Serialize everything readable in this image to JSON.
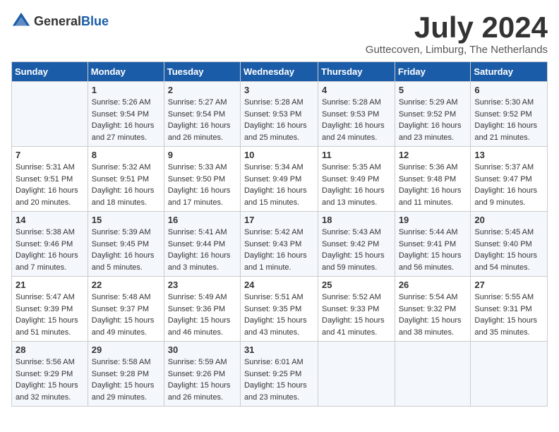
{
  "header": {
    "logo": {
      "text1": "General",
      "text2": "Blue"
    },
    "title": "July 2024",
    "location": "Guttecoven, Limburg, The Netherlands"
  },
  "columns": [
    "Sunday",
    "Monday",
    "Tuesday",
    "Wednesday",
    "Thursday",
    "Friday",
    "Saturday"
  ],
  "weeks": [
    [
      {
        "day": "",
        "info": ""
      },
      {
        "day": "1",
        "info": "Sunrise: 5:26 AM\nSunset: 9:54 PM\nDaylight: 16 hours\nand 27 minutes."
      },
      {
        "day": "2",
        "info": "Sunrise: 5:27 AM\nSunset: 9:54 PM\nDaylight: 16 hours\nand 26 minutes."
      },
      {
        "day": "3",
        "info": "Sunrise: 5:28 AM\nSunset: 9:53 PM\nDaylight: 16 hours\nand 25 minutes."
      },
      {
        "day": "4",
        "info": "Sunrise: 5:28 AM\nSunset: 9:53 PM\nDaylight: 16 hours\nand 24 minutes."
      },
      {
        "day": "5",
        "info": "Sunrise: 5:29 AM\nSunset: 9:52 PM\nDaylight: 16 hours\nand 23 minutes."
      },
      {
        "day": "6",
        "info": "Sunrise: 5:30 AM\nSunset: 9:52 PM\nDaylight: 16 hours\nand 21 minutes."
      }
    ],
    [
      {
        "day": "7",
        "info": "Sunrise: 5:31 AM\nSunset: 9:51 PM\nDaylight: 16 hours\nand 20 minutes."
      },
      {
        "day": "8",
        "info": "Sunrise: 5:32 AM\nSunset: 9:51 PM\nDaylight: 16 hours\nand 18 minutes."
      },
      {
        "day": "9",
        "info": "Sunrise: 5:33 AM\nSunset: 9:50 PM\nDaylight: 16 hours\nand 17 minutes."
      },
      {
        "day": "10",
        "info": "Sunrise: 5:34 AM\nSunset: 9:49 PM\nDaylight: 16 hours\nand 15 minutes."
      },
      {
        "day": "11",
        "info": "Sunrise: 5:35 AM\nSunset: 9:49 PM\nDaylight: 16 hours\nand 13 minutes."
      },
      {
        "day": "12",
        "info": "Sunrise: 5:36 AM\nSunset: 9:48 PM\nDaylight: 16 hours\nand 11 minutes."
      },
      {
        "day": "13",
        "info": "Sunrise: 5:37 AM\nSunset: 9:47 PM\nDaylight: 16 hours\nand 9 minutes."
      }
    ],
    [
      {
        "day": "14",
        "info": "Sunrise: 5:38 AM\nSunset: 9:46 PM\nDaylight: 16 hours\nand 7 minutes."
      },
      {
        "day": "15",
        "info": "Sunrise: 5:39 AM\nSunset: 9:45 PM\nDaylight: 16 hours\nand 5 minutes."
      },
      {
        "day": "16",
        "info": "Sunrise: 5:41 AM\nSunset: 9:44 PM\nDaylight: 16 hours\nand 3 minutes."
      },
      {
        "day": "17",
        "info": "Sunrise: 5:42 AM\nSunset: 9:43 PM\nDaylight: 16 hours\nand 1 minute."
      },
      {
        "day": "18",
        "info": "Sunrise: 5:43 AM\nSunset: 9:42 PM\nDaylight: 15 hours\nand 59 minutes."
      },
      {
        "day": "19",
        "info": "Sunrise: 5:44 AM\nSunset: 9:41 PM\nDaylight: 15 hours\nand 56 minutes."
      },
      {
        "day": "20",
        "info": "Sunrise: 5:45 AM\nSunset: 9:40 PM\nDaylight: 15 hours\nand 54 minutes."
      }
    ],
    [
      {
        "day": "21",
        "info": "Sunrise: 5:47 AM\nSunset: 9:39 PM\nDaylight: 15 hours\nand 51 minutes."
      },
      {
        "day": "22",
        "info": "Sunrise: 5:48 AM\nSunset: 9:37 PM\nDaylight: 15 hours\nand 49 minutes."
      },
      {
        "day": "23",
        "info": "Sunrise: 5:49 AM\nSunset: 9:36 PM\nDaylight: 15 hours\nand 46 minutes."
      },
      {
        "day": "24",
        "info": "Sunrise: 5:51 AM\nSunset: 9:35 PM\nDaylight: 15 hours\nand 43 minutes."
      },
      {
        "day": "25",
        "info": "Sunrise: 5:52 AM\nSunset: 9:33 PM\nDaylight: 15 hours\nand 41 minutes."
      },
      {
        "day": "26",
        "info": "Sunrise: 5:54 AM\nSunset: 9:32 PM\nDaylight: 15 hours\nand 38 minutes."
      },
      {
        "day": "27",
        "info": "Sunrise: 5:55 AM\nSunset: 9:31 PM\nDaylight: 15 hours\nand 35 minutes."
      }
    ],
    [
      {
        "day": "28",
        "info": "Sunrise: 5:56 AM\nSunset: 9:29 PM\nDaylight: 15 hours\nand 32 minutes."
      },
      {
        "day": "29",
        "info": "Sunrise: 5:58 AM\nSunset: 9:28 PM\nDaylight: 15 hours\nand 29 minutes."
      },
      {
        "day": "30",
        "info": "Sunrise: 5:59 AM\nSunset: 9:26 PM\nDaylight: 15 hours\nand 26 minutes."
      },
      {
        "day": "31",
        "info": "Sunrise: 6:01 AM\nSunset: 9:25 PM\nDaylight: 15 hours\nand 23 minutes."
      },
      {
        "day": "",
        "info": ""
      },
      {
        "day": "",
        "info": ""
      },
      {
        "day": "",
        "info": ""
      }
    ]
  ]
}
